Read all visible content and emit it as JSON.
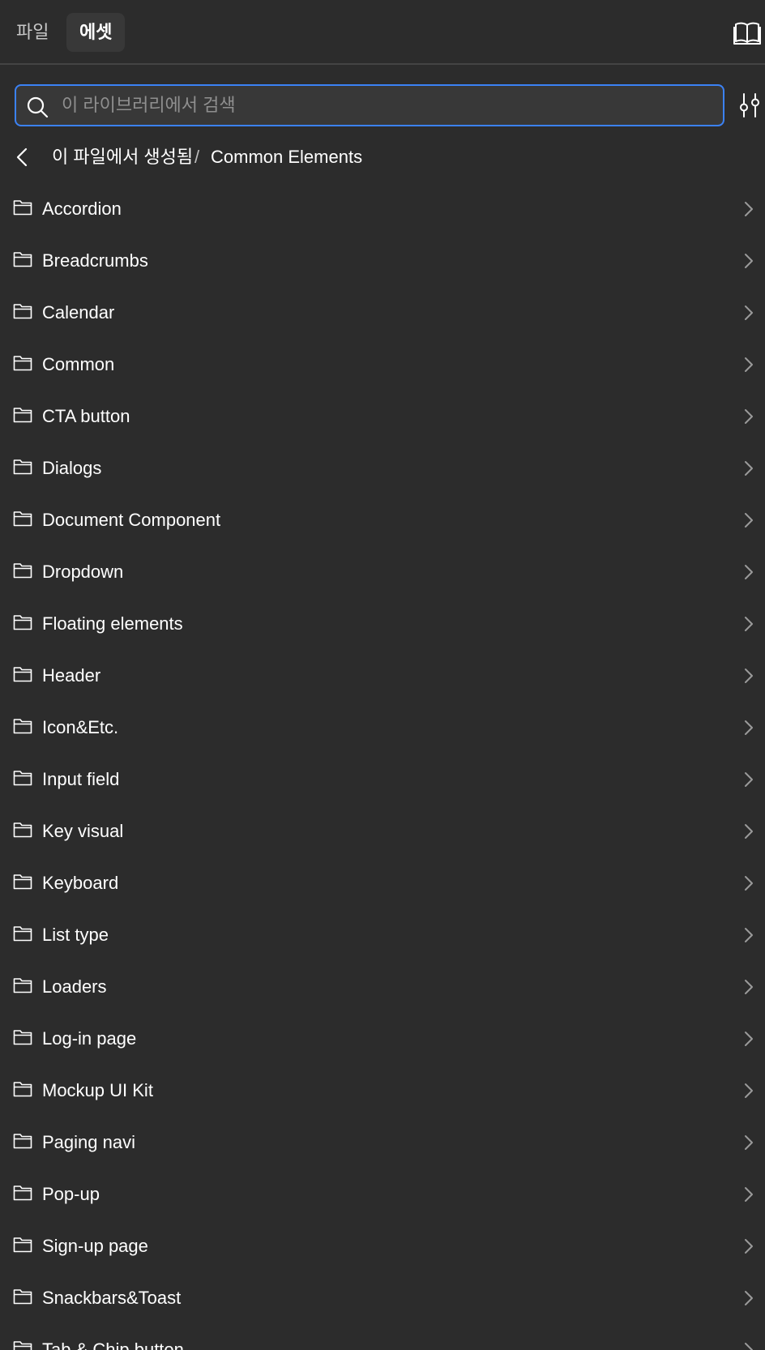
{
  "tabs": {
    "files_label": "파일",
    "assets_label": "에셋"
  },
  "search": {
    "value": "",
    "placeholder": "이 라이브러리에서 검색"
  },
  "breadcrumb": {
    "parent": "이 파일에서 생성됨",
    "separator": "/",
    "current": "Common Elements"
  },
  "folders": [
    "Accordion",
    "Breadcrumbs",
    "Calendar",
    "Common",
    "CTA button",
    "Dialogs",
    "Document Component",
    "Dropdown",
    "Floating elements",
    "Header",
    "Icon&Etc.",
    "Input field",
    "Key visual",
    "Keyboard",
    "List type",
    "Loaders",
    "Log-in page",
    "Mockup UI Kit",
    "Paging navi",
    "Pop-up",
    "Sign-up page",
    "Snackbars&Toast",
    "Tab & Chip button"
  ],
  "icons": {
    "library": "book-icon",
    "search": "search-icon",
    "filter": "sliders-icon",
    "back": "chevron-left-icon",
    "folder": "folder-icon",
    "row_arrow": "chevron-right-icon"
  },
  "colors": {
    "background": "#2c2c2c",
    "search_focus_border": "#3b82f6",
    "active_tab_bg": "#383838",
    "divider": "#444444"
  }
}
